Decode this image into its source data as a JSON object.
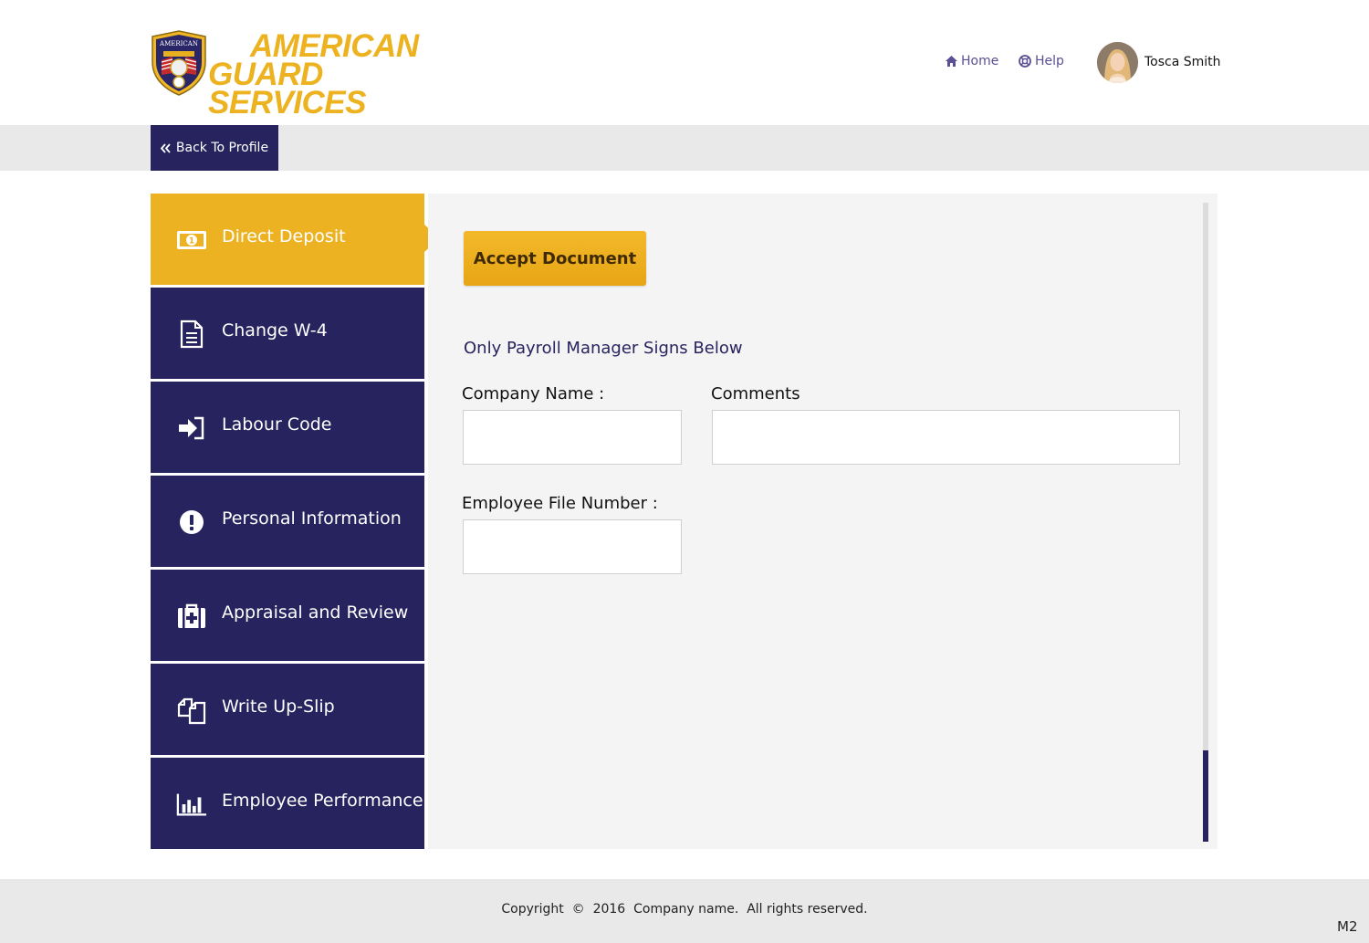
{
  "brand": {
    "name_line1": "AMERICAN",
    "name_line2": "GUARD SERVICES",
    "badge_text": "AMERICAN",
    "color": "#ecb21f"
  },
  "header": {
    "nav": [
      {
        "label": "Home",
        "icon": "home-icon"
      },
      {
        "label": "Help",
        "icon": "lifebuoy-icon"
      }
    ],
    "user": {
      "name": "Tosca Smith"
    }
  },
  "toolbar": {
    "back_label": "Back To Profile",
    "back_icon": "double-chevron-left-icon"
  },
  "sidebar": {
    "items": [
      {
        "label": "Direct Deposit",
        "icon": "money-bill-icon",
        "active": true
      },
      {
        "label": "Change W-4",
        "icon": "document-icon",
        "active": false
      },
      {
        "label": "Labour Code",
        "icon": "sign-in-icon",
        "active": false
      },
      {
        "label": "Personal Information",
        "icon": "exclamation-circle-icon",
        "active": false
      },
      {
        "label": "Appraisal and Review",
        "icon": "medical-kit-icon",
        "active": false
      },
      {
        "label": "Write Up-Slip",
        "icon": "copy-files-icon",
        "active": false
      },
      {
        "label": "Employee Performance",
        "icon": "bar-chart-icon",
        "active": false
      }
    ]
  },
  "main": {
    "accept_label": "Accept Document",
    "subhead": "Only Payroll Manager Signs Below",
    "fields": {
      "company_name": {
        "label": "Company Name :",
        "value": ""
      },
      "comments": {
        "label": "Comments",
        "value": ""
      },
      "employee_file_number": {
        "label": "Employee File Number :",
        "value": ""
      }
    }
  },
  "footer": {
    "copyright": "Copyright  ©  2016  Company name.  All rights reserved.",
    "tag": "M2"
  },
  "colors": {
    "navy": "#27235f",
    "gold": "#ecb221",
    "panel": "#f4f4f4"
  }
}
